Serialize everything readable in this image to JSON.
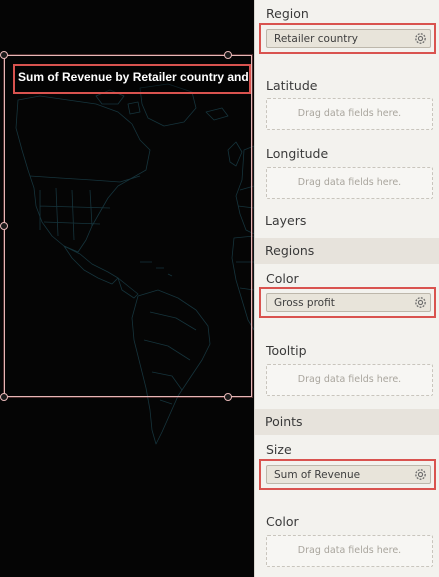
{
  "chart": {
    "title": "Sum of Revenue by Retailer country and Gross profit"
  },
  "panel": {
    "region": {
      "label": "Region",
      "field": "Retailer country",
      "field_icon": "gear-icon"
    },
    "latitude": {
      "label": "Latitude",
      "placeholder": "Drag data fields here."
    },
    "longitude": {
      "label": "Longitude",
      "placeholder": "Drag data fields here."
    },
    "layers_label": "Layers",
    "regions_section": "Regions",
    "regions_color": {
      "label": "Color",
      "field": "Gross profit",
      "field_icon": "gear-icon"
    },
    "regions_tooltip": {
      "label": "Tooltip",
      "placeholder": "Drag data fields here."
    },
    "points_section": "Points",
    "points_size": {
      "label": "Size",
      "field": "Sum of Revenue",
      "field_icon": "gear-icon"
    },
    "points_color": {
      "label": "Color",
      "placeholder": "Drag data fields here."
    }
  },
  "colors": {
    "highlight": "#d9534f",
    "panel_bg": "#f3f2ee",
    "section_bg": "#e7e3dc",
    "map_outline": "#16343c"
  }
}
